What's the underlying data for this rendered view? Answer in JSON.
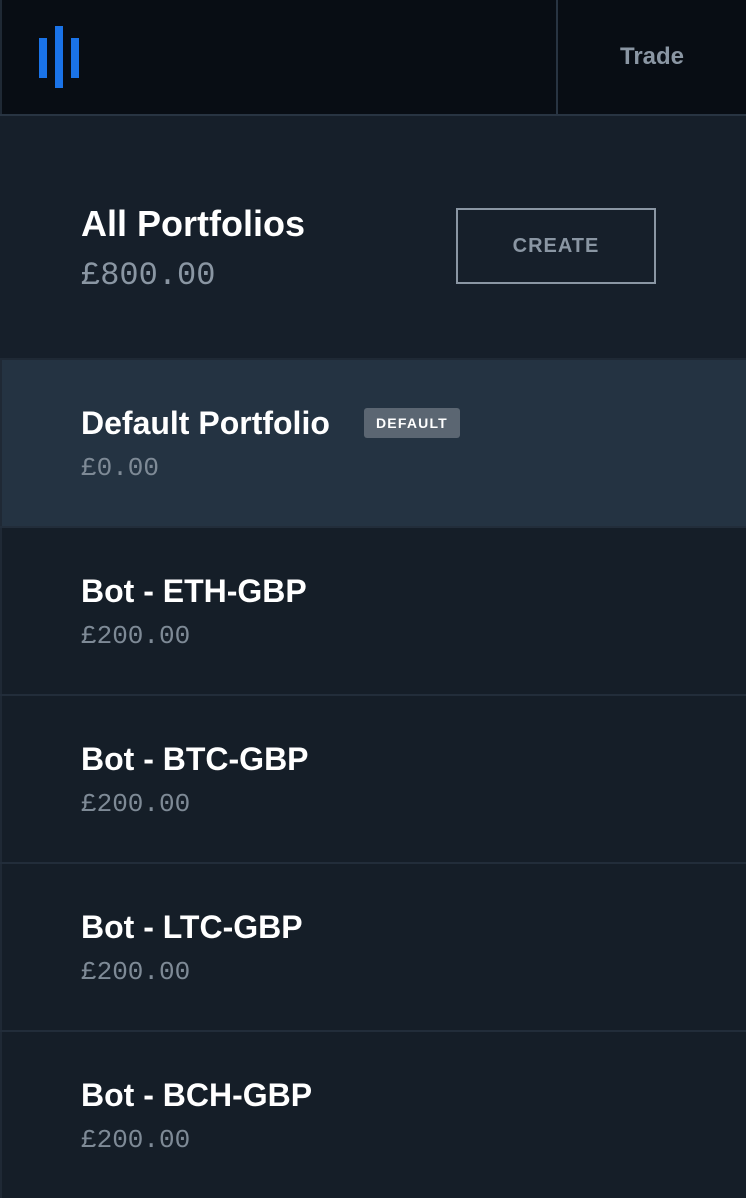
{
  "header": {
    "logo_icon": "bars-logo-icon",
    "nav_trade": "Trade",
    "accent_color": "#1a73e8"
  },
  "summary": {
    "title": "All Portfolios",
    "total_value": "£800.00",
    "create_label": "CREATE"
  },
  "portfolios": [
    {
      "name": "Default Portfolio",
      "value": "£0.00",
      "badge": "DEFAULT",
      "selected": true
    },
    {
      "name": "Bot - ETH-GBP",
      "value": "£200.00"
    },
    {
      "name": "Bot - BTC-GBP",
      "value": "£200.00"
    },
    {
      "name": "Bot - LTC-GBP",
      "value": "£200.00"
    },
    {
      "name": "Bot - BCH-GBP",
      "value": "£200.00"
    }
  ]
}
